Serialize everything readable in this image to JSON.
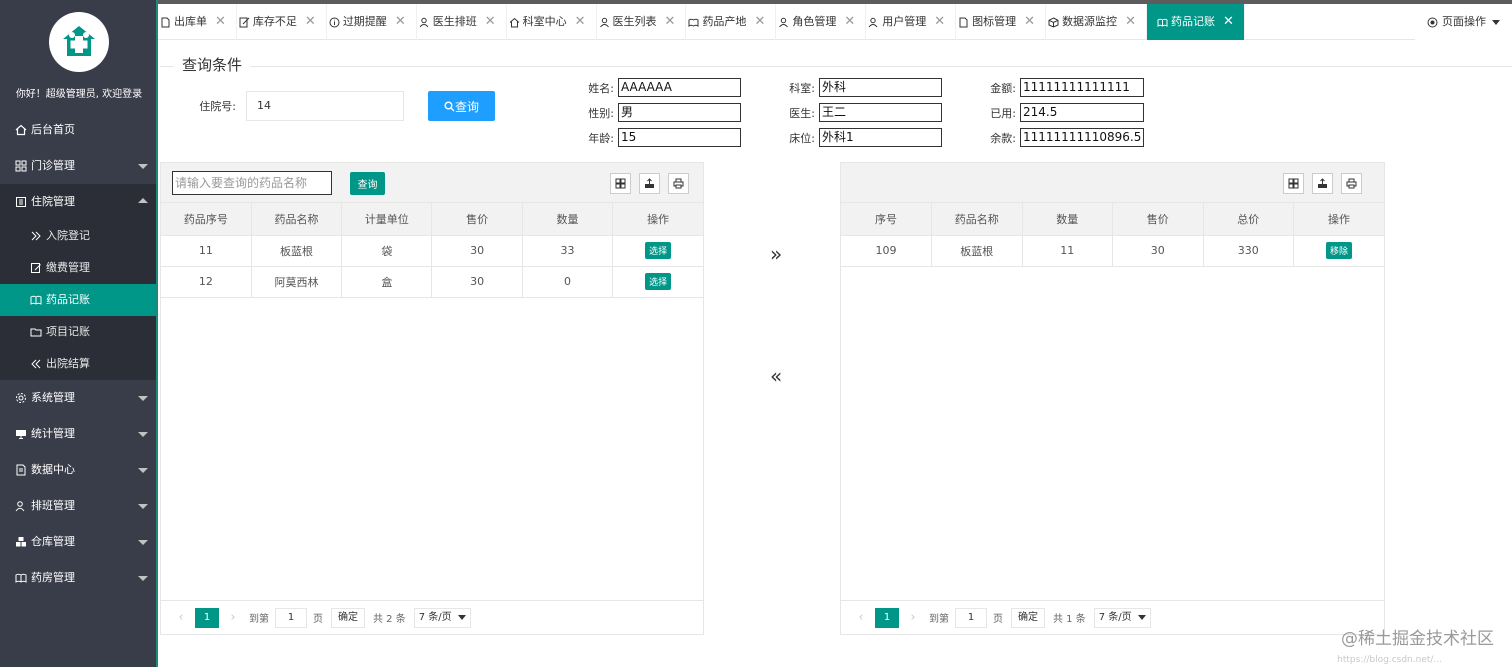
{
  "sidebar": {
    "welcome": "你好！超级管理员, 欢迎登录",
    "items": [
      {
        "label": "后台首页"
      },
      {
        "label": "门诊管理"
      },
      {
        "label": "住院管理"
      },
      {
        "label": "系统管理"
      },
      {
        "label": "统计管理"
      },
      {
        "label": "数据中心"
      },
      {
        "label": "排班管理"
      },
      {
        "label": "仓库管理"
      },
      {
        "label": "药房管理"
      }
    ],
    "sub_items": [
      {
        "label": "入院登记"
      },
      {
        "label": "缴费管理"
      },
      {
        "label": "药品记账"
      },
      {
        "label": "项目记账"
      },
      {
        "label": "出院结算"
      }
    ]
  },
  "tabs": [
    {
      "label": "出库单"
    },
    {
      "label": "库存不足"
    },
    {
      "label": "过期提醒"
    },
    {
      "label": "医生排班"
    },
    {
      "label": "科室中心"
    },
    {
      "label": "医生列表"
    },
    {
      "label": "药品产地"
    },
    {
      "label": "角色管理"
    },
    {
      "label": "用户管理"
    },
    {
      "label": "图标管理"
    },
    {
      "label": "数据源监控"
    },
    {
      "label": "药品记账"
    }
  ],
  "page_op": "页面操作",
  "query": {
    "title": "查询条件",
    "hospital_no_label": "住院号:",
    "hospital_no_value": "14",
    "query_button": "查询",
    "fields": {
      "name_label": "姓名:",
      "name_value": "AAAAAA",
      "gender_label": "性别:",
      "gender_value": "男",
      "age_label": "年龄:",
      "age_value": "15",
      "dept_label": "科室:",
      "dept_value": "外科",
      "doctor_label": "医生:",
      "doctor_value": "王二",
      "bed_label": "床位:",
      "bed_value": "外科1",
      "amount_label": "金额:",
      "amount_value": "11111111111111",
      "used_label": "已用:",
      "used_value": "214.5",
      "balance_label": "余款:",
      "balance_value": "11111111110896.5"
    }
  },
  "left_table": {
    "search_placeholder": "请输入要查询的药品名称",
    "search_button": "查询",
    "headers": [
      "药品序号",
      "药品名称",
      "计量单位",
      "售价",
      "数量",
      "操作"
    ],
    "rows": [
      {
        "id": "11",
        "name": "板蓝根",
        "unit": "袋",
        "price": "30",
        "qty": "33",
        "op": "选择"
      },
      {
        "id": "12",
        "name": "阿莫西林",
        "unit": "盒",
        "price": "30",
        "qty": "0",
        "op": "选择"
      }
    ],
    "pager": {
      "page": "1",
      "goto": "到第",
      "input": "1",
      "page_unit": "页",
      "ok": "确定",
      "total": "共 2 条",
      "per_page": "7 条/页"
    }
  },
  "right_table": {
    "headers": [
      "序号",
      "药品名称",
      "数量",
      "售价",
      "总价",
      "操作"
    ],
    "rows": [
      {
        "id": "109",
        "name": "板蓝根",
        "qty": "11",
        "price": "30",
        "total": "330",
        "op": "移除"
      }
    ],
    "pager": {
      "page": "1",
      "goto": "到第",
      "input": "1",
      "page_unit": "页",
      "ok": "确定",
      "total": "共 1 条",
      "per_page": "7 条/页"
    }
  },
  "arrows": {
    "right": "»",
    "left": "«"
  },
  "watermark": "@稀土掘金技术社区",
  "watermark_url": "https://blog.csdn.net/...",
  "colors": {
    "sidebar": "#393d49",
    "accent": "#009688",
    "primary_button": "#1e9fff"
  }
}
